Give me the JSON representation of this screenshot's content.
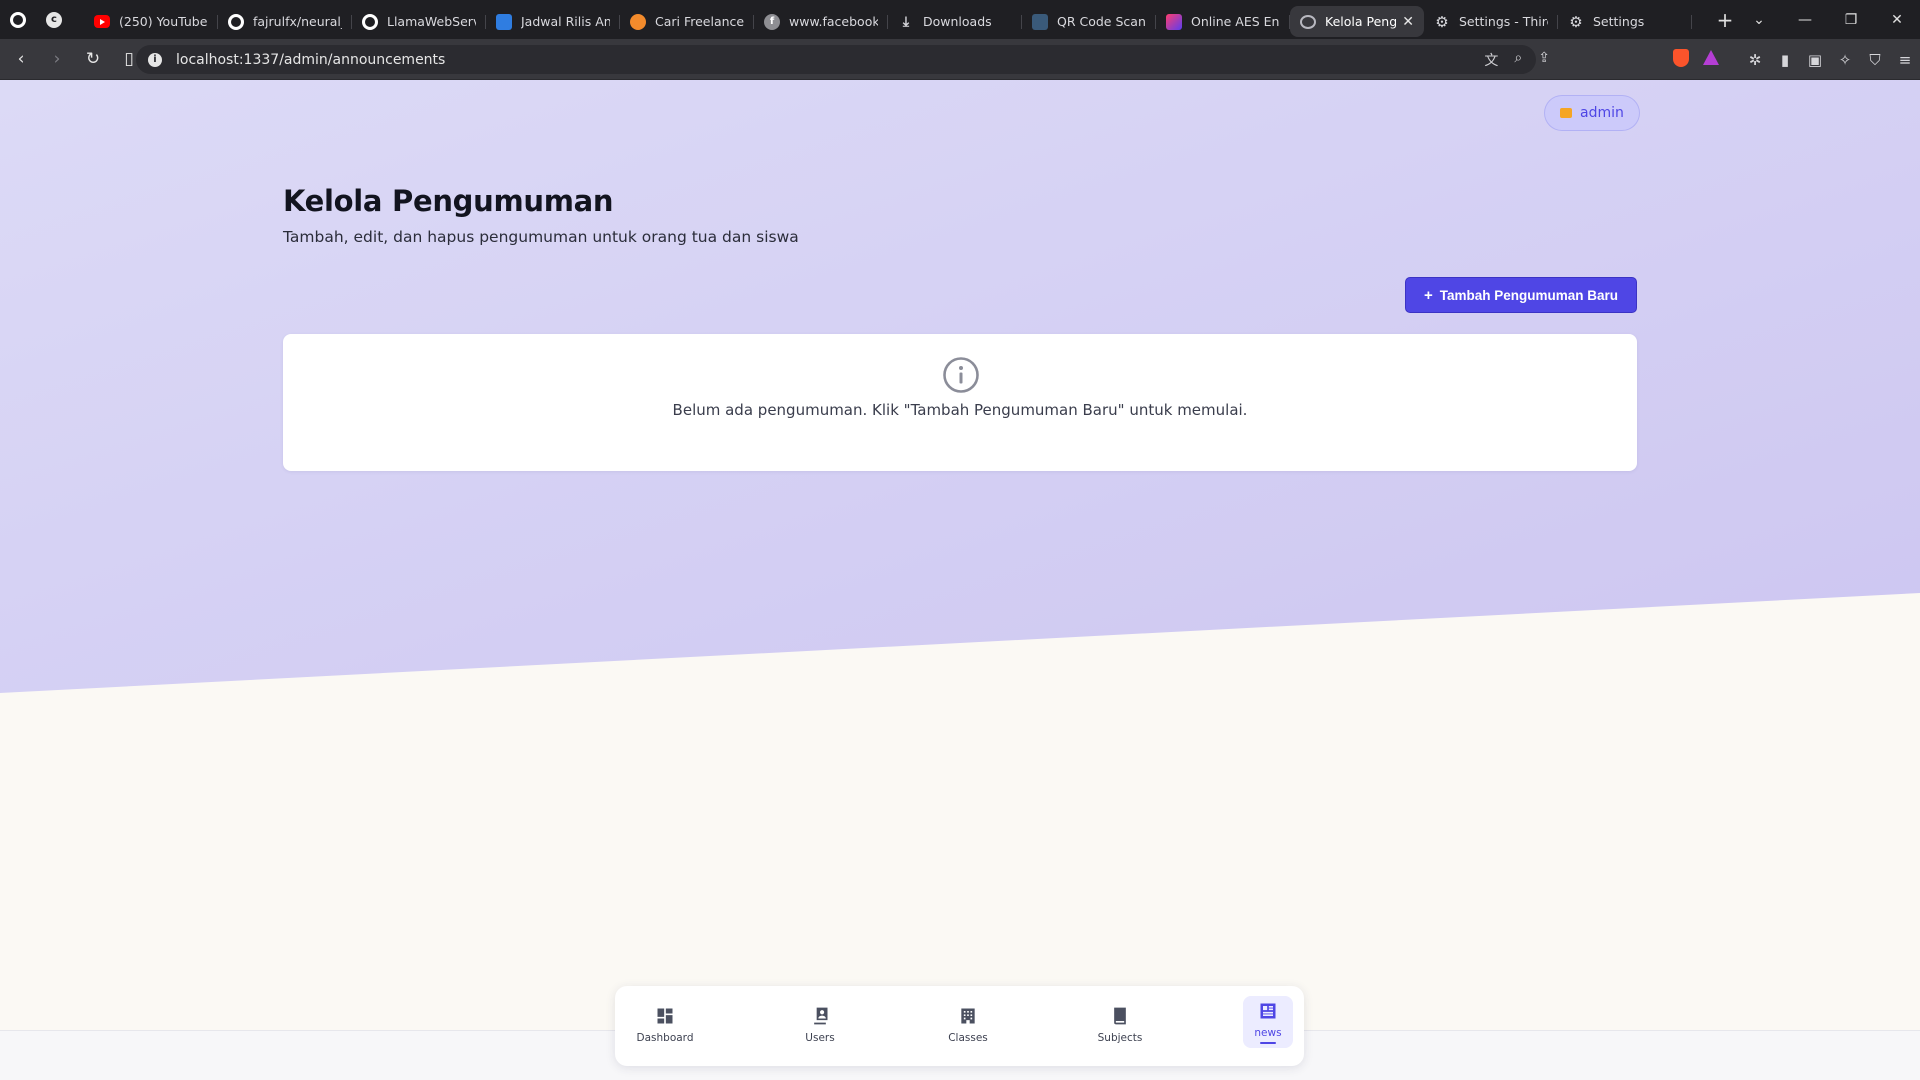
{
  "browser": {
    "tabs": [
      {
        "title": "(250) YouTube",
        "icon": "youtube-icon"
      },
      {
        "title": "fajrulfx/neural_n",
        "icon": "github-icon"
      },
      {
        "title": "LlamaWebServe",
        "icon": "github-icon"
      },
      {
        "title": "Jadwal Rilis Ani",
        "icon": "site-icon"
      },
      {
        "title": "Cari Freelancer I",
        "icon": "site-icon"
      },
      {
        "title": "www.facebook.c",
        "icon": "facebook-icon"
      },
      {
        "title": "Downloads",
        "icon": "download-icon"
      },
      {
        "title": "QR Code Scann",
        "icon": "qr-icon"
      },
      {
        "title": "Online AES Enc",
        "icon": "site-icon"
      },
      {
        "title": "Kelola Peng",
        "icon": "globe-icon",
        "active": true
      },
      {
        "title": "Settings - Third",
        "icon": "gear-icon"
      },
      {
        "title": "Settings",
        "icon": "gear-icon"
      }
    ],
    "url": "localhost:1337/admin/announcements"
  },
  "header": {
    "user_label": "admin"
  },
  "main": {
    "title": "Kelola Pengumuman",
    "subtitle": "Tambah, edit, dan hapus pengumuman untuk orang tua dan siswa",
    "add_button_label": "Tambah Pengumuman Baru",
    "empty_message": "Belum ada pengumuman. Klik \"Tambah Pengumuman Baru\" untuk memulai."
  },
  "bottom_nav": {
    "items": [
      {
        "label": "Dashboard",
        "icon": "dashboard-icon"
      },
      {
        "label": "Users",
        "icon": "users-icon"
      },
      {
        "label": "Classes",
        "icon": "building-icon"
      },
      {
        "label": "Subjects",
        "icon": "book-icon"
      },
      {
        "label": "news",
        "icon": "news-icon",
        "active": true
      }
    ]
  },
  "colors": {
    "accent": "#4f46e5",
    "bg_gradient_start": "#dcdaf6",
    "bg_gradient_end": "#cdc6f1",
    "bg_lower": "#fbf9f4"
  }
}
